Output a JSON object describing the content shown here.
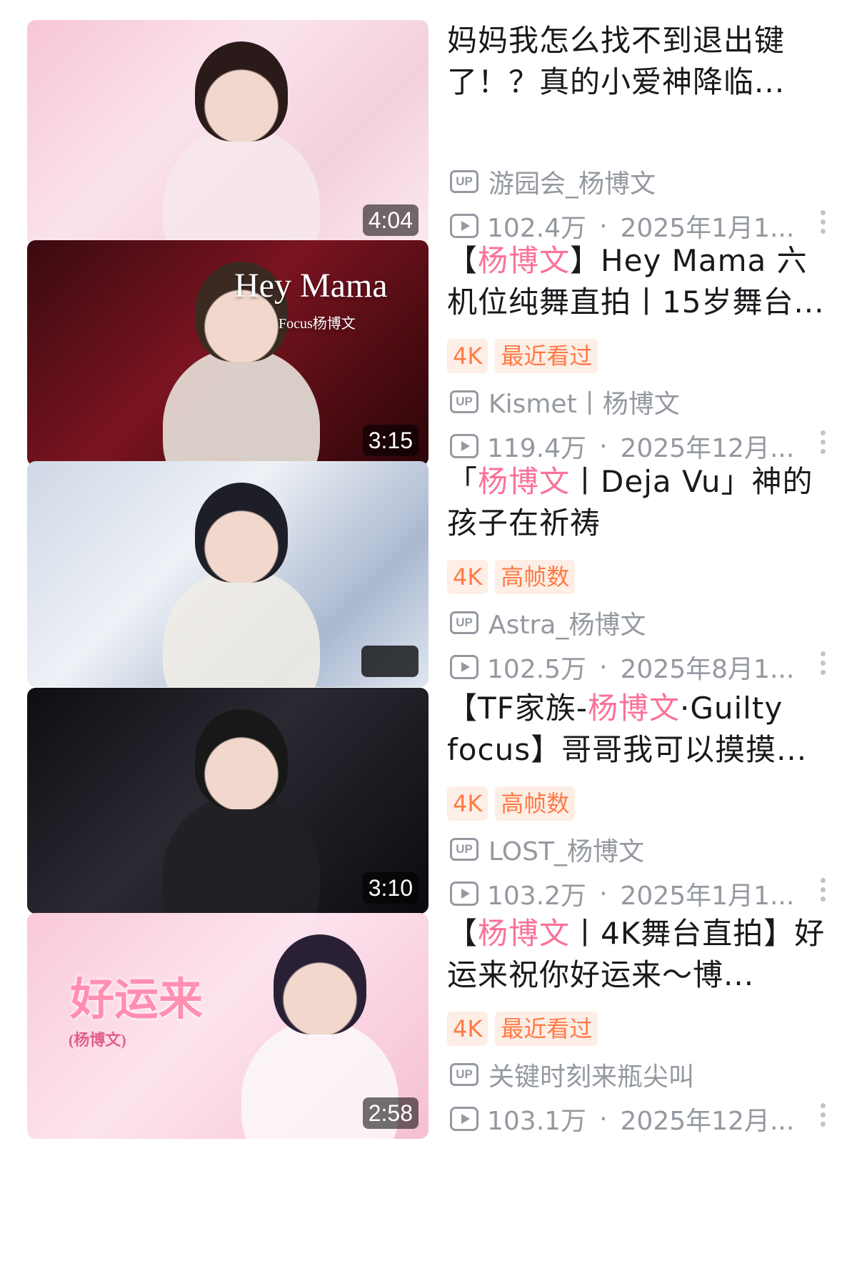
{
  "videos": [
    {
      "title_parts": [
        {
          "text": "妈妈我怎么找不到退出键了！？真的小爱神降临...",
          "highlight": false
        }
      ],
      "tags": [],
      "duration": "4:04",
      "uploader": "游园会_杨博文",
      "views": "102.4万",
      "date": "2025年1月1...",
      "thumb_bg": "linear-gradient(135deg,#f7c6d6 0%,#fbe3ec 40%,#f3d0de 70%,#fce8f0 100%)"
    },
    {
      "title_parts": [
        {
          "text": "【",
          "highlight": false
        },
        {
          "text": "杨博文",
          "highlight": true
        },
        {
          "text": "】Hey Mama 六机位纯舞直拍丨15岁舞台...",
          "highlight": false
        }
      ],
      "tags": [
        "4K",
        "最近看过"
      ],
      "duration": "3:15",
      "overlay_title": "Hey Mama",
      "overlay_sub": "Focus杨博文",
      "uploader": "Kismet丨杨博文",
      "views": "119.4万",
      "date": "2025年12月...",
      "thumb_bg": "linear-gradient(135deg,#3a0a10 0%,#7a1420 45%,#2a0508 100%)"
    },
    {
      "title_parts": [
        {
          "text": "「",
          "highlight": false
        },
        {
          "text": "杨博文",
          "highlight": true
        },
        {
          "text": "丨Deja Vu」神的孩子在祈祷",
          "highlight": false
        }
      ],
      "tags": [
        "4K",
        "高帧数"
      ],
      "duration": "",
      "uploader": "Astra_杨博文",
      "views": "102.5万",
      "date": "2025年8月1...",
      "thumb_bg": "linear-gradient(135deg,#cfd8e6 0%,#eef1f6 40%,#aab8d0 75%,#dfe6f0 100%)"
    },
    {
      "title_parts": [
        {
          "text": "【TF家族-",
          "highlight": false
        },
        {
          "text": "杨博文",
          "highlight": true
        },
        {
          "text": "·Guilty focus】哥哥我可以摸摸...",
          "highlight": false
        }
      ],
      "tags": [
        "4K",
        "高帧数"
      ],
      "duration": "3:10",
      "uploader": "LOST_杨博文",
      "views": "103.2万",
      "date": "2025年1月1...",
      "thumb_bg": "linear-gradient(135deg,#0d0d12 0%,#2a2a33 45%,#0a0a0e 100%)"
    },
    {
      "title_parts": [
        {
          "text": "【",
          "highlight": false
        },
        {
          "text": "杨博文",
          "highlight": true
        },
        {
          "text": "丨4K舞台直拍】好运来祝你好运来～博...",
          "highlight": false
        }
      ],
      "tags": [
        "4K",
        "最近看过"
      ],
      "duration": "2:58",
      "overlay_pink": "好运来",
      "overlay_pink_sub": "(杨博文)",
      "uploader": "关键时刻来瓶尖叫",
      "views": "103.1万",
      "date": "2025年12月...",
      "thumb_bg": "linear-gradient(135deg,#f9c9d9 0%,#fde4ee 45%,#f6bfd3 100%)"
    }
  ],
  "icons": {
    "up": "UP",
    "dot_sep": "·"
  },
  "colors": {
    "highlight": "#fb7299",
    "tag_text": "#ff7a45",
    "tag_bg": "#fdeee6",
    "meta": "#9499a0"
  }
}
